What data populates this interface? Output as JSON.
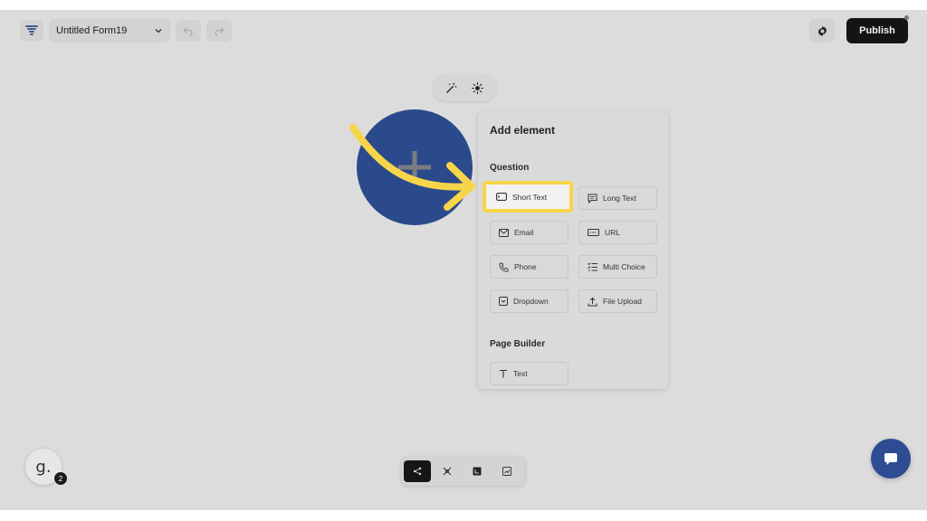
{
  "header": {
    "form_name": "Untitled Form19",
    "publish_label": "Publish"
  },
  "panel": {
    "title": "Add element",
    "question_section": "Question",
    "page_builder_section": "Page Builder",
    "question_items": [
      {
        "label": "Short Text",
        "icon": "short-text-icon"
      },
      {
        "label": "Long Text",
        "icon": "long-text-icon"
      },
      {
        "label": "Email",
        "icon": "email-icon"
      },
      {
        "label": "URL",
        "icon": "url-icon"
      },
      {
        "label": "Phone",
        "icon": "phone-icon"
      },
      {
        "label": "Multi Choice",
        "icon": "multi-choice-icon"
      },
      {
        "label": "Dropdown",
        "icon": "dropdown-icon"
      },
      {
        "label": "File Upload",
        "icon": "file-upload-icon"
      }
    ],
    "page_builder_items": [
      {
        "label": "Text",
        "icon": "text-icon"
      }
    ]
  },
  "user": {
    "avatar_letter": "g.",
    "badge_count": "2"
  },
  "colors": {
    "accent_blue": "#2b4a8b",
    "highlight_yellow": "#f7d54a",
    "publish_bg": "#141414"
  }
}
